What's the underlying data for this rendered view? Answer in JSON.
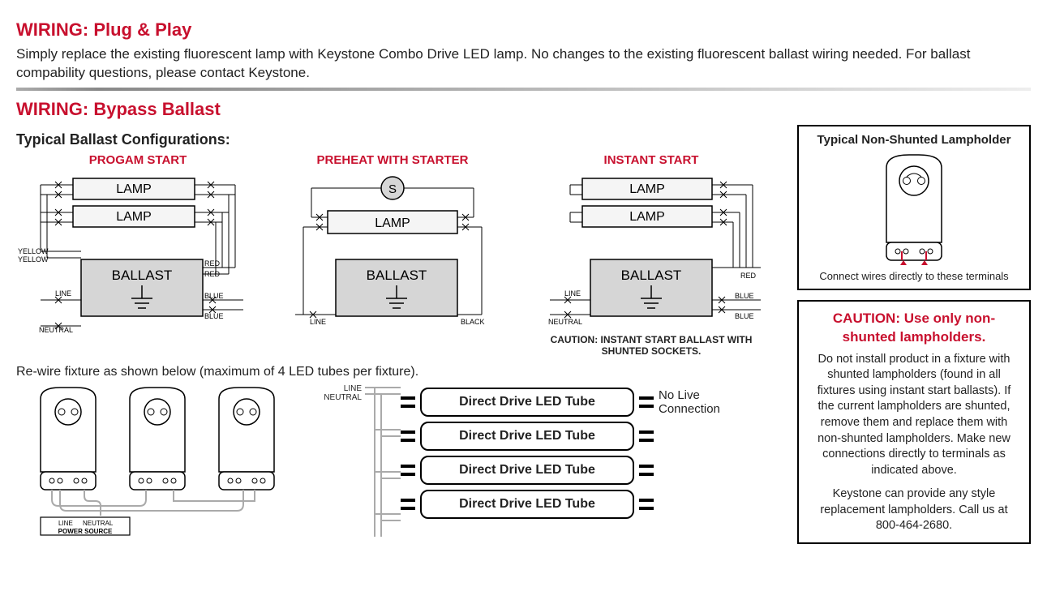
{
  "section1": {
    "title": "WIRING: Plug & Play",
    "body": "Simply replace the existing fluorescent lamp with Keystone Combo Drive LED lamp. No changes to the existing fluorescent ballast wiring needed. For ballast compability questions, please contact Keystone."
  },
  "section2": {
    "title": "WIRING: Bypass Ballast",
    "subtitle": "Typical Ballast Configurations:",
    "rewire_text": "Re-wire fixture as shown below (maximum of 4 LED tubes per fixture)."
  },
  "configs": {
    "program": {
      "title": "PROGAM START",
      "lamp": "LAMP",
      "ballast": "BALLAST",
      "wires": {
        "yellow": "YELLOW",
        "line": "LINE",
        "neutral": "NEUTRAL",
        "red": "RED",
        "blue": "BLUE"
      }
    },
    "preheat": {
      "title": "PREHEAT WITH STARTER",
      "starter": "S",
      "lamp": "LAMP",
      "ballast": "BALLAST",
      "wires": {
        "line": "LINE",
        "black": "BLACK"
      }
    },
    "instant": {
      "title": "INSTANT START",
      "lamp": "LAMP",
      "ballast": "BALLAST",
      "wires": {
        "line": "LINE",
        "neutral": "NEUTRAL",
        "red": "RED",
        "blue": "BLUE"
      },
      "caution": "CAUTION: INSTANT START BALLAST WITH SHUNTED SOCKETS."
    }
  },
  "tubes": {
    "line": "LINE",
    "neutral": "NEUTRAL",
    "label": "Direct Drive LED Tube",
    "no_live": "No Live Connection"
  },
  "power_source": {
    "line": "LINE",
    "neutral": "NEUTRAL",
    "label": "POWER SOURCE"
  },
  "sidebar": {
    "lampholder": {
      "title": "Typical Non-Shunted Lampholder",
      "foot": "Connect wires directly to these terminals"
    },
    "caution": {
      "head": "CAUTION: Use only non-shunted lampholders.",
      "body": "Do not install product in a fixture with shunted lampholders (found in all fixtures using instant start ballasts). If the current lampholders are shunted, remove them and replace them with non-shunted lampholders. Make new connections directly to terminals as indicated above.",
      "foot": "Keystone can provide any style replacement lampholders. Call us at 800-464-2680."
    }
  }
}
